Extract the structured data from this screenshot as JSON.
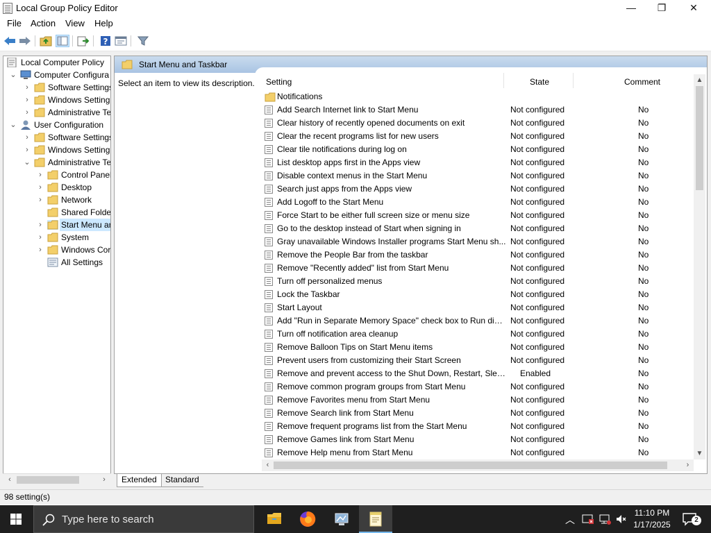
{
  "window": {
    "title": "Local Group Policy Editor",
    "minimize": "—",
    "maximize": "❐",
    "close": "✕"
  },
  "menu": [
    "File",
    "Action",
    "View",
    "Help"
  ],
  "tree": {
    "root": "Local Computer Policy",
    "computer_config": "Computer Configura",
    "cc_software": "Software Settings",
    "cc_windows": "Windows Setting",
    "cc_admin": "Administrative Te",
    "user_config": "User Configuration",
    "uc_software": "Software Settings",
    "uc_windows": "Windows Setting",
    "uc_admin": "Administrative Te",
    "control_panel": "Control Panel",
    "desktop": "Desktop",
    "network": "Network",
    "shared_folders": "Shared Folder",
    "start_menu": "Start Menu ar",
    "system": "System",
    "windows_components": "Windows Cor",
    "all_settings": "All Settings"
  },
  "panel": {
    "header": "Start Menu and Taskbar",
    "description": "Select an item to view its description.",
    "col_setting": "Setting",
    "col_state": "State",
    "col_comment": "Comment",
    "folder_item": "Notifications"
  },
  "settings": [
    {
      "name": "Add Search Internet link to Start Menu",
      "state": "Not configured",
      "comment": "No"
    },
    {
      "name": "Clear history of recently opened documents on exit",
      "state": "Not configured",
      "comment": "No"
    },
    {
      "name": "Clear the recent programs list for new users",
      "state": "Not configured",
      "comment": "No"
    },
    {
      "name": "Clear tile notifications during log on",
      "state": "Not configured",
      "comment": "No"
    },
    {
      "name": "List desktop apps first in the Apps view",
      "state": "Not configured",
      "comment": "No"
    },
    {
      "name": "Disable context menus in the Start Menu",
      "state": "Not configured",
      "comment": "No"
    },
    {
      "name": "Search just apps from the Apps view",
      "state": "Not configured",
      "comment": "No"
    },
    {
      "name": "Add Logoff to the Start Menu",
      "state": "Not configured",
      "comment": "No"
    },
    {
      "name": "Force Start to be either full screen size or menu size",
      "state": "Not configured",
      "comment": "No"
    },
    {
      "name": "Go to the desktop instead of Start when signing in",
      "state": "Not configured",
      "comment": "No"
    },
    {
      "name": "Gray unavailable Windows Installer programs Start Menu sh...",
      "state": "Not configured",
      "comment": "No"
    },
    {
      "name": "Remove the People Bar from the taskbar",
      "state": "Not configured",
      "comment": "No"
    },
    {
      "name": "Remove \"Recently added\" list from Start Menu",
      "state": "Not configured",
      "comment": "No"
    },
    {
      "name": "Turn off personalized menus",
      "state": "Not configured",
      "comment": "No"
    },
    {
      "name": "Lock the Taskbar",
      "state": "Not configured",
      "comment": "No"
    },
    {
      "name": "Start Layout",
      "state": "Not configured",
      "comment": "No"
    },
    {
      "name": "Add \"Run in Separate Memory Space\" check box to Run dial...",
      "state": "Not configured",
      "comment": "No"
    },
    {
      "name": "Turn off notification area cleanup",
      "state": "Not configured",
      "comment": "No"
    },
    {
      "name": "Remove Balloon Tips on Start Menu items",
      "state": "Not configured",
      "comment": "No"
    },
    {
      "name": "Prevent users from customizing their Start Screen",
      "state": "Not configured",
      "comment": "No"
    },
    {
      "name": "Remove and prevent access to the Shut Down, Restart, Sleep...",
      "state": "Enabled",
      "comment": "No"
    },
    {
      "name": "Remove common program groups from Start Menu",
      "state": "Not configured",
      "comment": "No"
    },
    {
      "name": "Remove Favorites menu from Start Menu",
      "state": "Not configured",
      "comment": "No"
    },
    {
      "name": "Remove Search link from Start Menu",
      "state": "Not configured",
      "comment": "No"
    },
    {
      "name": "Remove frequent programs list from the Start Menu",
      "state": "Not configured",
      "comment": "No"
    },
    {
      "name": "Remove Games link from Start Menu",
      "state": "Not configured",
      "comment": "No"
    },
    {
      "name": "Remove Help menu from Start Menu",
      "state": "Not configured",
      "comment": "No"
    }
  ],
  "tabs": {
    "extended": "Extended",
    "standard": "Standard"
  },
  "status": "98 setting(s)",
  "taskbar": {
    "search_placeholder": "Type here to search",
    "time": "11:10 PM",
    "date": "1/17/2025",
    "notification_count": "2"
  }
}
